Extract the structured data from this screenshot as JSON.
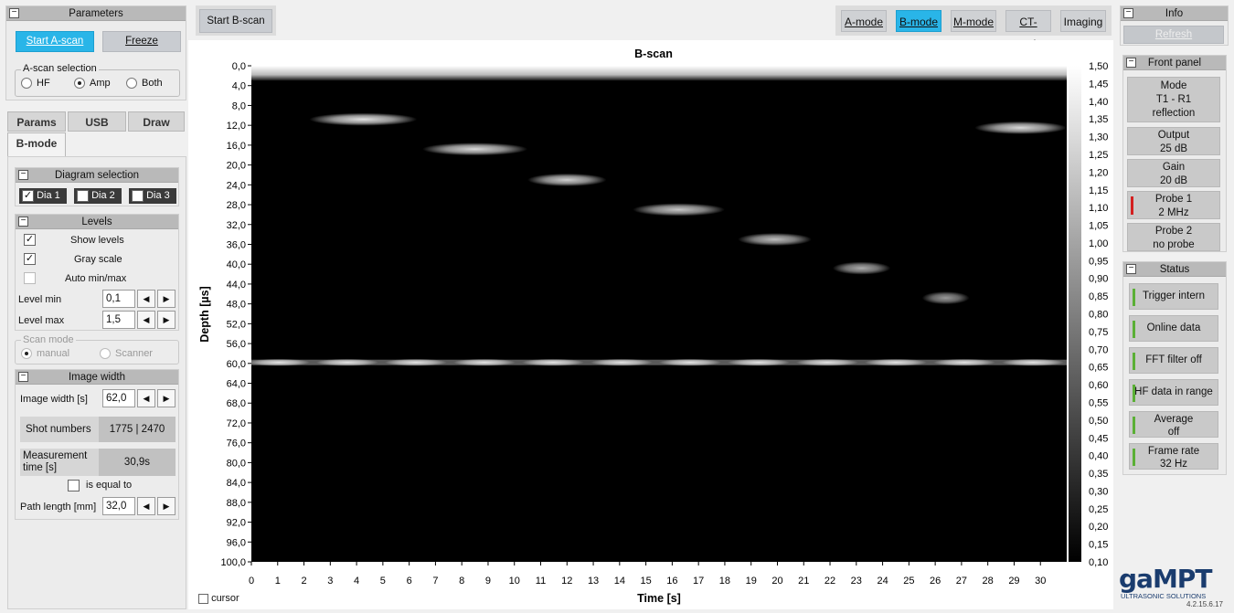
{
  "params_panel": {
    "title": "Parameters",
    "start_ascan_label": "Start A-scan",
    "freeze_label": "Freeze",
    "ascan_selection": {
      "legend": "A-scan selection",
      "options": [
        "HF",
        "Amp",
        "Both"
      ],
      "selected": "Amp"
    },
    "tabs": [
      "Params",
      "USB",
      "Draw",
      "B-mode"
    ],
    "active_tab": "B-mode",
    "diagram_selection": {
      "title": "Diagram selection",
      "items": [
        {
          "label": "Dia 1",
          "checked": true
        },
        {
          "label": "Dia 2",
          "checked": false
        },
        {
          "label": "Dia 3",
          "checked": false
        }
      ]
    },
    "levels": {
      "title": "Levels",
      "show_levels": {
        "label": "Show levels",
        "checked": true
      },
      "gray_scale": {
        "label": "Gray scale",
        "checked": true
      },
      "auto_minmax": {
        "label": "Auto min/max",
        "checked": false
      },
      "level_min_label": "Level min",
      "level_min_value": "0,1",
      "level_max_label": "Level max",
      "level_max_value": "1,5"
    },
    "scan_mode": {
      "legend": "Scan mode",
      "options": [
        "manual",
        "Scanner"
      ],
      "selected": "manual"
    },
    "image_width": {
      "title": "Image width",
      "width_label": "Image width [s]",
      "width_value": "62,0",
      "shot_numbers_label": "Shot numbers",
      "shot_numbers_value": "1775 | 2470",
      "measurement_time_label": "Measurement time [s]",
      "measurement_time_value": "30,9s",
      "is_equal_label": "is equal to",
      "path_length_label": "Path length [mm]",
      "path_length_value": "32,0"
    }
  },
  "toolbar": {
    "start_bscan_label": "Start B-scan",
    "modes": [
      "A-mode",
      "B-mode",
      "M-mode",
      "CT-mode",
      "Imaging"
    ],
    "active_mode": "B-mode"
  },
  "chart_data": {
    "type": "heatmap",
    "title": "B-scan",
    "xlabel": "Time [s]",
    "ylabel": "Depth [µs]",
    "xlim": [
      0,
      31
    ],
    "ylim": [
      0,
      100
    ],
    "x_ticks": [
      "0",
      "1",
      "2",
      "3",
      "4",
      "5",
      "6",
      "7",
      "8",
      "9",
      "10",
      "11",
      "12",
      "13",
      "14",
      "15",
      "16",
      "17",
      "18",
      "19",
      "20",
      "21",
      "22",
      "23",
      "24",
      "25",
      "26",
      "27",
      "28",
      "29",
      "30"
    ],
    "y_ticks": [
      "0,0",
      "4,0",
      "8,0",
      "12,0",
      "16,0",
      "20,0",
      "24,0",
      "28,0",
      "32,0",
      "36,0",
      "40,0",
      "44,0",
      "48,0",
      "52,0",
      "56,0",
      "60,0",
      "64,0",
      "68,0",
      "72,0",
      "76,0",
      "80,0",
      "84,0",
      "88,0",
      "92,0",
      "96,0",
      "100,0"
    ],
    "colorbar_ticks": [
      "1,50",
      "1,45",
      "1,40",
      "1,35",
      "1,30",
      "1,25",
      "1,20",
      "1,15",
      "1,10",
      "1,05",
      "1,00",
      "0,95",
      "0,90",
      "0,85",
      "0,80",
      "0,75",
      "0,70",
      "0,65",
      "0,60",
      "0,55",
      "0,50",
      "0,45",
      "0,40",
      "0,35",
      "0,30",
      "0,25",
      "0,20",
      "0,15",
      "0,10"
    ],
    "colorbar_range": [
      0.1,
      1.5
    ],
    "echoes": [
      {
        "t_start": 2.2,
        "t_end": 6.3,
        "depth": 10.8,
        "intensity": 1.35
      },
      {
        "t_start": 6.5,
        "t_end": 10.5,
        "depth": 16.8,
        "intensity": 1.3
      },
      {
        "t_start": 10.5,
        "t_end": 13.5,
        "depth": 23.0,
        "intensity": 1.25
      },
      {
        "t_start": 14.5,
        "t_end": 18.0,
        "depth": 29.0,
        "intensity": 1.2
      },
      {
        "t_start": 18.5,
        "t_end": 21.3,
        "depth": 35.0,
        "intensity": 1.15
      },
      {
        "t_start": 22.1,
        "t_end": 24.3,
        "depth": 40.8,
        "intensity": 1.05
      },
      {
        "t_start": 25.5,
        "t_end": 27.3,
        "depth": 46.8,
        "intensity": 0.95
      },
      {
        "t_start": 27.5,
        "t_end": 31.0,
        "depth": 12.5,
        "intensity": 1.3
      },
      {
        "t_start": 0,
        "t_end": 31.0,
        "depth": 59.8,
        "intensity": 1.0
      },
      {
        "t_start": 0,
        "t_end": 31.0,
        "depth": 0.8,
        "intensity": 1.45
      }
    ],
    "cursor_label": "cursor",
    "cursor_checked": false
  },
  "info_panel": {
    "title": "Info",
    "refresh_label": "Refresh",
    "front_panel": {
      "title": "Front panel",
      "items": [
        {
          "label": "Mode",
          "value": "T1 - R1",
          "extra": "reflection"
        },
        {
          "label": "Output",
          "value": "25 dB"
        },
        {
          "label": "Gain",
          "value": "20 dB"
        },
        {
          "label": "Probe 1",
          "value": "2 MHz",
          "indicator": "#d32020"
        },
        {
          "label": "Probe 2",
          "value": "no probe"
        }
      ]
    },
    "status": {
      "title": "Status",
      "items": [
        {
          "label": "Trigger intern"
        },
        {
          "label": "Online data"
        },
        {
          "label": "FFT filter off"
        },
        {
          "label": "HF data in range"
        },
        {
          "label": "Average",
          "value": "off"
        },
        {
          "label": "Frame rate",
          "value": "32 Hz"
        }
      ],
      "indicator_color": "#5ab035"
    }
  },
  "brand": {
    "logo": "gaMPT",
    "tagline": "ULTRASONIC SOLUTIONS",
    "version": "4.2.15.6.17"
  }
}
